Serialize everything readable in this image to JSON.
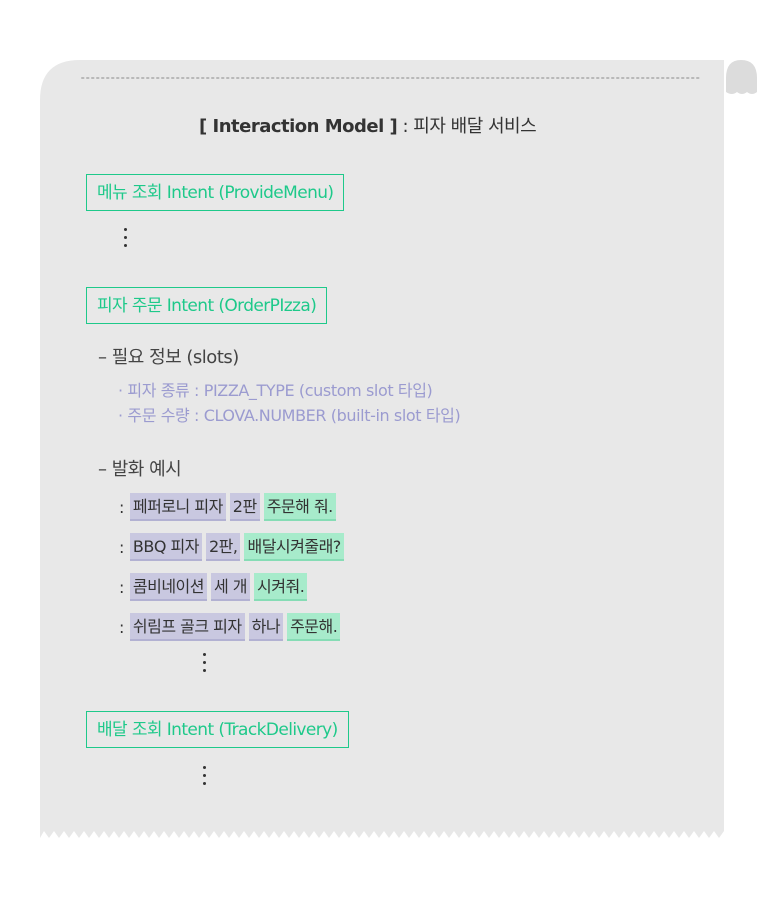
{
  "title": {
    "bracket_text": "[ Interaction Model ]",
    "separator": " : ",
    "service": "피자 배달 서비스"
  },
  "colors": {
    "paper": "#e8e8e8",
    "intent_green": "#1ec98a",
    "slot_purple": "#9b9bd0",
    "slot_chip": "#c9c8e0",
    "carrier_chip": "#a7ebcb"
  },
  "intents": {
    "menu": {
      "label": "메뉴 조회 Intent (ProvideMenu)"
    },
    "order": {
      "label": "피자 주문 Intent (OrderPIzza)"
    },
    "delivery": {
      "label": "배달 조회 Intent (TrackDelivery)"
    }
  },
  "slots_section": {
    "heading": "– 필요 정보 (slots)",
    "items": [
      "· 피자 종류 : PIZZA_TYPE (custom slot 타입)",
      "· 주문 수량 : CLOVA.NUMBER (built-in slot 타입)"
    ]
  },
  "utterance_section": {
    "heading": "– 발화 예시",
    "colon": ":",
    "utterances": [
      {
        "parts": [
          {
            "text": "페퍼로니 피자",
            "kind": "slot"
          },
          {
            "text": "2판",
            "kind": "slot"
          },
          {
            "text": "주문해 줘.",
            "kind": "carrier"
          }
        ]
      },
      {
        "parts": [
          {
            "text": "BBQ 피자",
            "kind": "slot"
          },
          {
            "text": "2판,",
            "kind": "slot"
          },
          {
            "text": "배달시켜줄래?",
            "kind": "carrier"
          }
        ]
      },
      {
        "parts": [
          {
            "text": "콤비네이션",
            "kind": "slot"
          },
          {
            "text": "세 개",
            "kind": "slot"
          },
          {
            "text": "시켜줘.",
            "kind": "carrier"
          }
        ]
      },
      {
        "parts": [
          {
            "text": "쉬림프 골크 피자",
            "kind": "slot"
          },
          {
            "text": "하나",
            "kind": "slot"
          },
          {
            "text": "주문해.",
            "kind": "carrier"
          }
        ]
      }
    ]
  }
}
